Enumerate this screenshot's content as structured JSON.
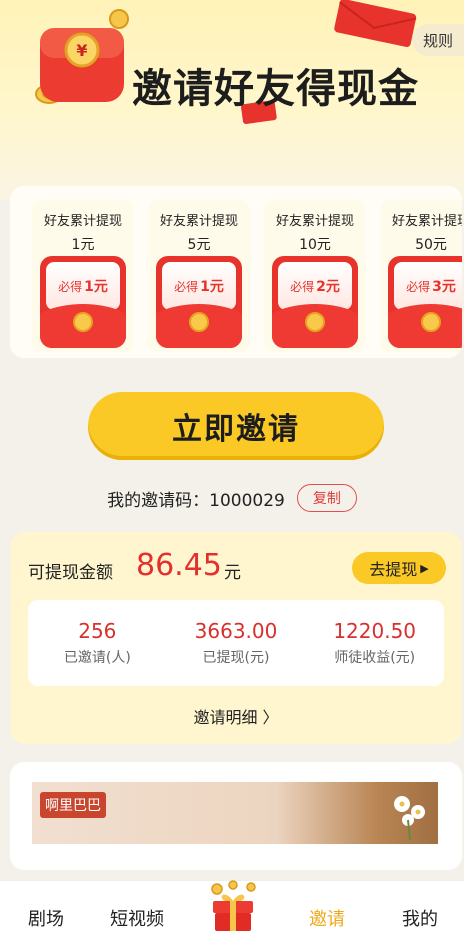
{
  "hero": {
    "title": "邀请好友得现金",
    "rules_label": "规则"
  },
  "rewards": [
    {
      "condition": "好友累计提现",
      "threshold": "1元",
      "reward_prefix": "必得",
      "reward_value": "1元"
    },
    {
      "condition": "好友累计提现",
      "threshold": "5元",
      "reward_prefix": "必得",
      "reward_value": "1元"
    },
    {
      "condition": "好友累计提现",
      "threshold": "10元",
      "reward_prefix": "必得",
      "reward_value": "2元"
    },
    {
      "condition": "好友累计提现",
      "threshold": "50元",
      "reward_prefix": "必得",
      "reward_value": "3元"
    }
  ],
  "invite": {
    "button_label": "立即邀请",
    "code_label": "我的邀请码：",
    "code": "1000029",
    "copy_label": "复制"
  },
  "earnings": {
    "label": "可提现金额",
    "amount": "86.45",
    "unit": "元",
    "withdraw_label": "去提现",
    "stats": [
      {
        "value": "256",
        "label": "已邀请(人)"
      },
      {
        "value": "3663.00",
        "label": "已提现(元)"
      },
      {
        "value": "1220.50",
        "label": "师徒收益(元)"
      }
    ],
    "detail_link": "邀请明细 〉"
  },
  "banner": {
    "tag": "啊里巴巴"
  },
  "nav": {
    "items": [
      "剧场",
      "短视频",
      "邀请",
      "我的"
    ],
    "active": "邀请"
  },
  "colors": {
    "accent_yellow": "#fbc925",
    "accent_red": "#e3302f",
    "active_nav": "#f0a818"
  }
}
